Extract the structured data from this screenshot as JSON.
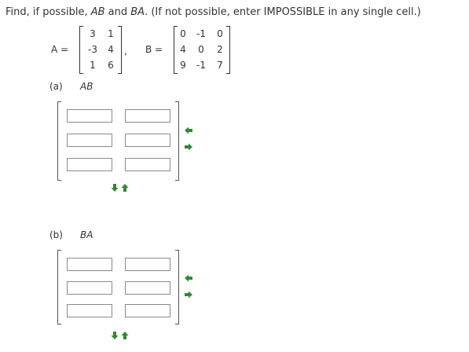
{
  "question": {
    "prefix": "Find, if possible, ",
    "ab": "AB",
    "and": " and ",
    "ba": "BA",
    "suffix": ". (If not possible, enter IMPOSSIBLE in any single cell.)"
  },
  "matrix_a": {
    "label": "A =",
    "rows": [
      [
        "3",
        "1"
      ],
      [
        "-3",
        "4"
      ],
      [
        "1",
        "6"
      ]
    ],
    "separator": ","
  },
  "matrix_b": {
    "label": "B =",
    "rows": [
      [
        "0",
        "-1",
        "0"
      ],
      [
        "4",
        "0",
        "2"
      ],
      [
        "9",
        "-1",
        "7"
      ]
    ]
  },
  "part_a": {
    "label": "(a)",
    "product": "AB",
    "rows": 3,
    "cols": 2,
    "values": [
      [
        "",
        ""
      ],
      [
        "",
        ""
      ],
      [
        "",
        ""
      ]
    ]
  },
  "part_b": {
    "label": "(b)",
    "product": "BA",
    "rows": 3,
    "cols": 2,
    "values": [
      [
        "",
        ""
      ],
      [
        "",
        ""
      ],
      [
        "",
        ""
      ]
    ]
  },
  "colors": {
    "arrow": "#2e8b2e",
    "text": "#333333",
    "cell_border": "#8a8a8a"
  },
  "icons": {
    "remove_column": "arrow-left-icon",
    "add_column": "arrow-right-icon",
    "remove_row": "arrow-up-icon",
    "add_row": "arrow-down-icon"
  }
}
